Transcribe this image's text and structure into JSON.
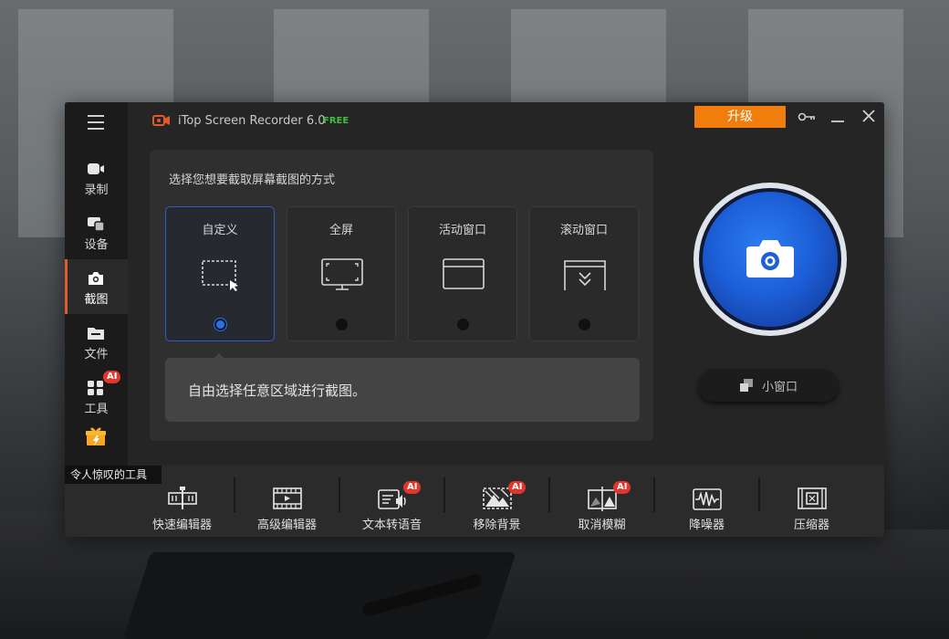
{
  "app": {
    "title": "iTop Screen Recorder 6.0",
    "edition": "FREE",
    "upgrade_label": "升级",
    "accent_color": "#f07d0c",
    "brand_color": "#e05a2b"
  },
  "sidebar": {
    "items": [
      {
        "label": "录制",
        "icon": "video-camera-icon"
      },
      {
        "label": "设备",
        "icon": "devices-icon"
      },
      {
        "label": "截图",
        "icon": "camera-icon",
        "active": true
      },
      {
        "label": "文件",
        "icon": "folder-icon"
      },
      {
        "label": "工具",
        "icon": "tools-grid-icon",
        "badge": "AI"
      },
      {
        "icon": "gift-icon"
      }
    ],
    "tooltip": "令人惊叹的工具"
  },
  "screenshot_panel": {
    "prompt": "选择您想要截取屏幕截图的方式",
    "modes": [
      {
        "label": "自定义",
        "icon": "custom-region-icon",
        "selected": true
      },
      {
        "label": "全屏",
        "icon": "full-screen-icon",
        "selected": false
      },
      {
        "label": "活动窗口",
        "icon": "active-window-icon",
        "selected": false
      },
      {
        "label": "滚动窗口",
        "icon": "scrolling-window-icon",
        "selected": false
      }
    ],
    "description": "自由选择任意区域进行截图。"
  },
  "capture": {
    "icon": "camera-icon",
    "mini_window_label": "小窗口"
  },
  "toolbar": {
    "tools": [
      {
        "label": "快速编辑器",
        "icon": "quick-editor-icon"
      },
      {
        "label": "高级编辑器",
        "icon": "advanced-editor-icon"
      },
      {
        "label": "文本转语音",
        "icon": "text-to-speech-icon",
        "badge": "AI"
      },
      {
        "label": "移除背景",
        "icon": "remove-background-icon",
        "badge": "AI"
      },
      {
        "label": "取消模糊",
        "icon": "unblur-icon",
        "badge": "AI"
      },
      {
        "label": "降噪器",
        "icon": "denoiser-icon"
      },
      {
        "label": "压缩器",
        "icon": "compressor-icon"
      }
    ]
  }
}
